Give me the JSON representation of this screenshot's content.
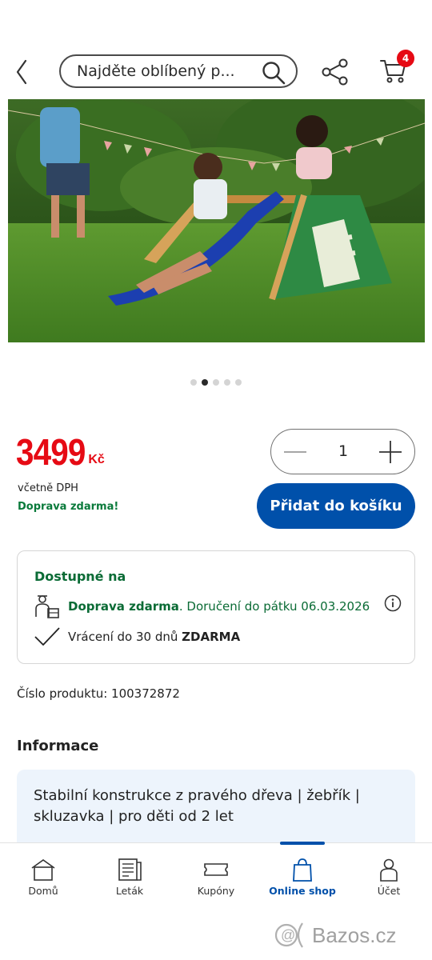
{
  "header": {
    "search_placeholder": "Najděte oblíbený p...",
    "cart_count": "4"
  },
  "gallery": {
    "slides": 5,
    "active_index": 1
  },
  "product": {
    "price": "3499",
    "currency": "Kč",
    "vat_note": "včetně DPH",
    "shipping_note": "Doprava zdarma!",
    "quantity": "1",
    "add_to_cart_label": "Přidat do košíku",
    "product_number_label": "Číslo produktu: 100372872"
  },
  "availability": {
    "title": "Dostupné na",
    "shipping_bold": "Doprava zdarma",
    "shipping_rest": ". Doručení do pátku 06.03.2026",
    "return_text": "Vrácení do 30 dnů ",
    "return_bold": "ZDARMA"
  },
  "info": {
    "title": "Informace",
    "description": "Stabilní konstrukce z pravého dřeva | žebřík | skluzavka | pro děti od 2 let"
  },
  "bottom_nav": {
    "items": [
      {
        "label": "Domů",
        "icon": "home-icon"
      },
      {
        "label": "Leták",
        "icon": "leaflet-icon"
      },
      {
        "label": "Kupóny",
        "icon": "coupon-icon"
      },
      {
        "label": "Online shop",
        "icon": "shopping-bag-icon"
      },
      {
        "label": "Účet",
        "icon": "account-icon"
      }
    ],
    "active_index": 3
  },
  "watermark": "Bazos.cz",
  "colors": {
    "brand_blue": "#0050aa",
    "price_red": "#e60a14",
    "green": "#0a6b35",
    "info_bg": "#edf4fc"
  }
}
